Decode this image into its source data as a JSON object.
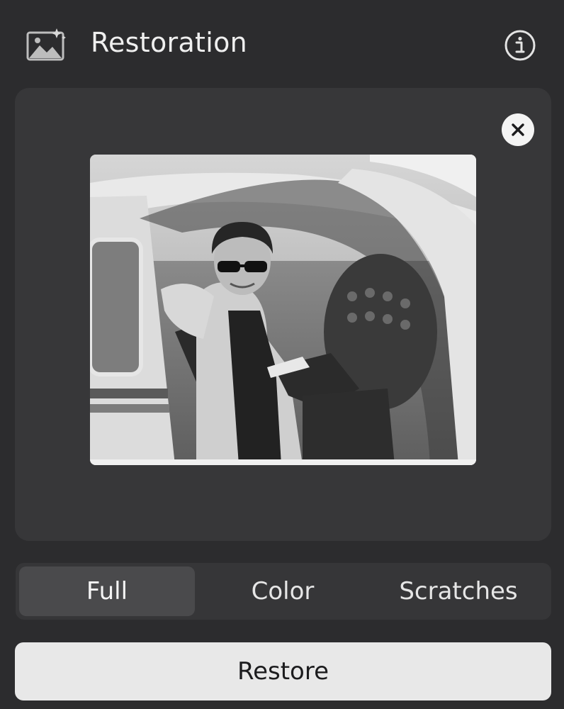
{
  "header": {
    "title": "Restoration",
    "app_icon": "photo-sparkle-icon",
    "info_icon": "info-circle-icon"
  },
  "preview": {
    "close_icon": "close-icon",
    "photo_description_icon": "photo-preview"
  },
  "modes": {
    "items": [
      {
        "label": "Full",
        "selected": true
      },
      {
        "label": "Color",
        "selected": false
      },
      {
        "label": "Scratches",
        "selected": false
      }
    ]
  },
  "actions": {
    "restore_label": "Restore"
  },
  "colors": {
    "panel_bg": "#2c2c2e",
    "card_bg": "#373739",
    "segment_active_bg": "#4a4a4c",
    "primary_button_bg": "#e8e8e8"
  }
}
